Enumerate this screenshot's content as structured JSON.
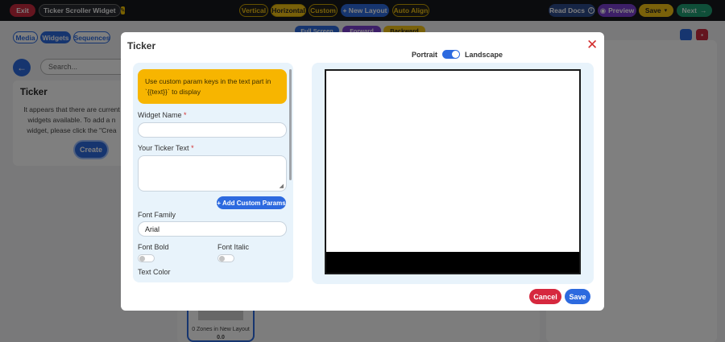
{
  "topbar": {
    "exit_label": "Exit",
    "widget_title": "Ticker Scroller Widget",
    "orientations": {
      "vertical": "Vertical",
      "horizontal": "Horizontal",
      "custom": "Custom"
    },
    "new_layout_label": "+ New Layout",
    "auto_align_label": "Auto Align",
    "read_docs_label": "Read Docs",
    "preview_label": "Preview",
    "save_label": "Save",
    "next_label": "Next"
  },
  "background": {
    "tabs": {
      "media": "Media",
      "widgets": "Widgets",
      "sequences": "Sequences"
    },
    "search_placeholder": "Search...",
    "card_title": "Ticker",
    "card_lines": [
      "It appears that there are current",
      "widgets available. To add a n",
      "widget, please click the \"Crea"
    ],
    "create_label": "Create",
    "zone_text": "0 Zones in New Layout",
    "zone_value": "0.0",
    "toolbar": {
      "full_screen": "Full Screen",
      "forward": "Forward",
      "backward": "Backward"
    }
  },
  "modal": {
    "title": "Ticker",
    "close_glyph": "✕",
    "orientation": {
      "portrait": "Portrait",
      "landscape": "Landscape"
    },
    "info_lines": [
      "Use custom param keys in the text part in",
      "`{{text}}` to display"
    ],
    "widget_name_label": "Widget Name",
    "widget_name_value": "",
    "ticker_text_label": "Your Ticker Text",
    "ticker_text_value": "",
    "required_mark": "*",
    "add_params_label": "+ Add Custom Params",
    "font_family_label": "Font Family",
    "font_family_value": "Arial",
    "font_bold_label": "Font Bold",
    "font_italic_label": "Font Italic",
    "text_color_label": "Text Color",
    "cancel_label": "Cancel",
    "save_label": "Save"
  }
}
